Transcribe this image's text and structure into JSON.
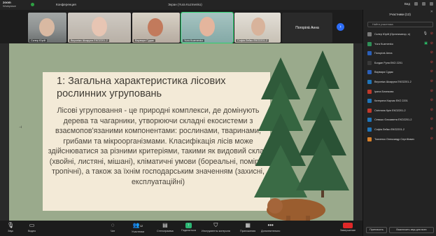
{
  "window": {
    "app_name": "zoom",
    "app_sub": "Workplace",
    "conference_label": "Конференция",
    "title": "Экран (Yura Kuzmenko)",
    "view_label": "Вид"
  },
  "gallery": [
    {
      "name": "Склер Юрій"
    },
    {
      "name": "Вероніка Шкарупа ЕКО2201-2"
    },
    {
      "name": "Варвара Судак"
    },
    {
      "name": "Yura Kuzmenko"
    },
    {
      "name": "Софія Лейко ЕКО2201-2"
    },
    {
      "name": "Погорілá Анна"
    }
  ],
  "slide": {
    "title": "1: Загальна характеристика лісових рослинних угруповань",
    "body": "Лісові угруповання - це природні комплекси, де домінують дерева та чагарники, утворюючи складні екосистеми з взаємопов'язаними компонентами: рослинами, тваринами, грибами та мікроорганізмами. Класифікація лісів може здійснюватися за різними критеріями, такими як видовий склад (хвойні, листяні, мішані), кліматичні умови (бореальні, помірні, тропічні), а також за їхнім господарським значенням (захисні, експлуатаційні)"
  },
  "toolbar": {
    "audio": "Звук",
    "video": "Видео",
    "chat": "Чат",
    "participants": "Участники",
    "participants_count": "12",
    "demo": "Стенограмма",
    "share": "Поделиться",
    "annotate": "Инструменты контроля",
    "apps": "Приложения",
    "more": "Дополнительно",
    "end": "Завершение"
  },
  "panel": {
    "title": "Участники (12)",
    "search_placeholder": "Найти участника",
    "participants": [
      {
        "name": "Склер Юрій (Организатор, я)",
        "color": "#7a7a7a"
      },
      {
        "name": "Yura Kuzmenko",
        "color": "#2f8f57"
      },
      {
        "name": "Погорілá Анна",
        "color": "#2b5fb8"
      },
      {
        "name": "Богдан Руля ЕКО 2201",
        "color": "#3a3a3a"
      },
      {
        "name": "Варвара Судак",
        "color": "#2b5fb8"
      },
      {
        "name": "Вероніка Шкарупа ЕКО2201-2",
        "color": "#1f74b8"
      },
      {
        "name": "Ірина Блинкова",
        "color": "#c0392b"
      },
      {
        "name": "Катерина Карчик ЕКО 2201",
        "color": "#1f74b8"
      },
      {
        "name": "Світлана Кріп ЕКО2201-2",
        "color": "#c0392b"
      },
      {
        "name": "Семько Єлизавета ЕКО2201-2",
        "color": "#1f74b8"
      },
      {
        "name": "Софія Лейко ЕКО2201-2",
        "color": "#1f74b8"
      },
      {
        "name": "Ткаченко Олександр Сергійович",
        "color": "#d7802a"
      }
    ],
    "invite": "Пригласить",
    "mute_all": "Выключить звук для всех"
  }
}
